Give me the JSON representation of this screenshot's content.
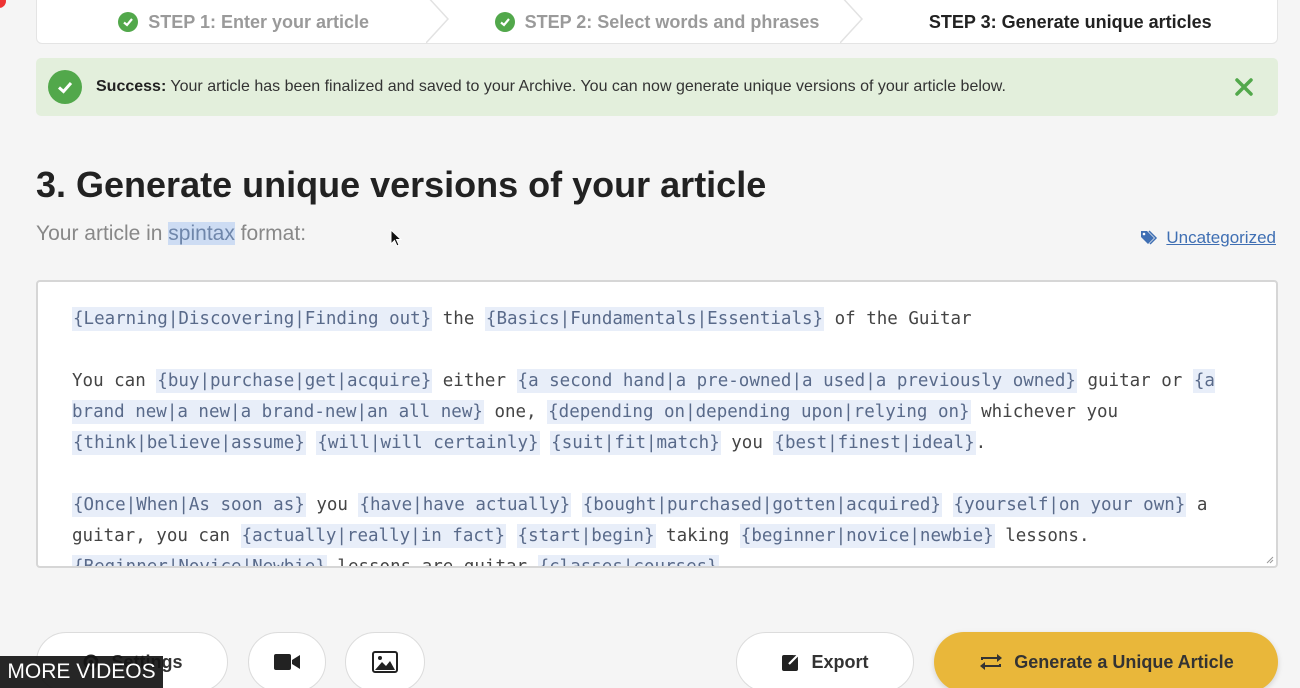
{
  "steps": [
    {
      "label": "STEP 1: Enter your article",
      "done": true
    },
    {
      "label": "STEP 2: Select words and phrases",
      "done": true
    },
    {
      "label": "STEP 3: Generate unique articles",
      "done": false
    }
  ],
  "alert": {
    "strong": "Success:",
    "message": " Your article has been finalized and saved to your Archive. You can now generate unique versions of your article below."
  },
  "main": {
    "title": "3. Generate unique versions of your article",
    "subtitle_before": "Your article in ",
    "subtitle_highlight": "spintax",
    "subtitle_after": " format:",
    "category": "Uncategorized"
  },
  "editor": {
    "paragraphs": [
      [
        {
          "s": "{Learning|Discovering|Finding out}"
        },
        {
          "t": " the "
        },
        {
          "s": "{Basics|Fundamentals|Essentials}"
        },
        {
          "t": " of the Guitar"
        }
      ],
      [
        {
          "t": "You can "
        },
        {
          "s": "{buy|purchase|get|acquire}"
        },
        {
          "t": " either "
        },
        {
          "s": "{a second hand|a pre-owned|a used|a previously owned}"
        },
        {
          "t": " guitar or "
        },
        {
          "s": "{a brand new|a new|a brand-new|an all new}"
        },
        {
          "t": " one, "
        },
        {
          "s": "{depending on|depending upon|relying on}"
        },
        {
          "t": " whichever you "
        },
        {
          "s": "{think|believe|assume}"
        },
        {
          "t": " "
        },
        {
          "s": "{will|will certainly}"
        },
        {
          "t": " "
        },
        {
          "s": "{suit|fit|match}"
        },
        {
          "t": " you "
        },
        {
          "s": "{best|finest|ideal}"
        },
        {
          "t": "."
        }
      ],
      [
        {
          "s": "{Once|When|As soon as}"
        },
        {
          "t": " you "
        },
        {
          "s": "{have|have actually}"
        },
        {
          "t": " "
        },
        {
          "s": "{bought|purchased|gotten|acquired}"
        },
        {
          "t": " "
        },
        {
          "s": "{yourself|on your own}"
        },
        {
          "t": " a guitar, you can "
        },
        {
          "s": "{actually|really|in fact}"
        },
        {
          "t": " "
        },
        {
          "s": "{start|begin}"
        },
        {
          "t": " taking "
        },
        {
          "s": "{beginner|novice|newbie}"
        },
        {
          "t": " lessons. "
        },
        {
          "s": "{Beginner|Novice|Newbie}"
        },
        {
          "t": " lessons are guitar "
        },
        {
          "s": "{classes|courses}"
        }
      ]
    ]
  },
  "buttons": {
    "settings": "Settings",
    "export": "Export",
    "generate": "Generate a Unique Article"
  },
  "overlay": {
    "more_videos": "MORE VIDEOS"
  },
  "colors": {
    "accent_green": "#52a84b",
    "success_bg": "#e3efdc",
    "generate_yellow": "#e9b73a",
    "link_blue": "#3f6fb3"
  }
}
